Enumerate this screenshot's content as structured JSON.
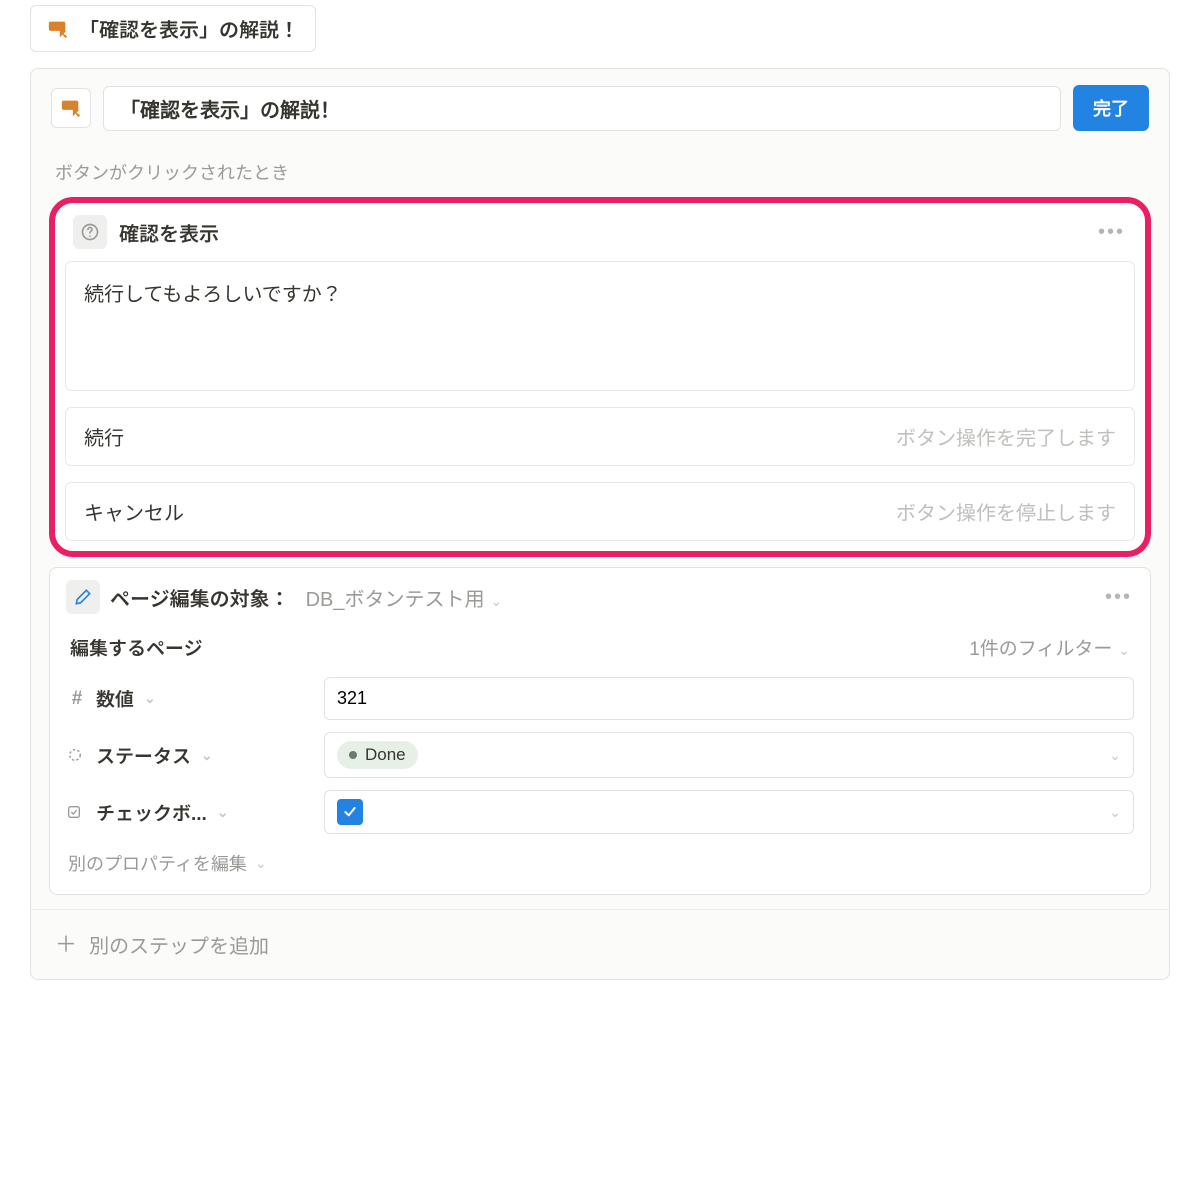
{
  "topChip": {
    "label": "「確認を表示」の解説！"
  },
  "header": {
    "title": "「確認を表示」の解説！",
    "done": "完了"
  },
  "trigger": "ボタンがクリックされたとき",
  "confirm": {
    "title": "確認を表示",
    "message": "続行してもよろしいですか？",
    "ok": {
      "label": "続行",
      "hint": "ボタン操作を完了します"
    },
    "cancel": {
      "label": "キャンセル",
      "hint": "ボタン操作を停止します"
    }
  },
  "edit": {
    "title": "ページ編集の対象：",
    "target": "DB_ボタンテスト用",
    "pagesLabel": "編集するページ",
    "filterLabel": "1件のフィルター",
    "props": {
      "number": {
        "key": "数値",
        "value": "321"
      },
      "status": {
        "key": "ステータス",
        "value": "Done"
      },
      "checkbox": {
        "key": "チェックボ...",
        "value": true
      }
    },
    "addProp": "別のプロパティを編集"
  },
  "addStep": "別のステップを追加"
}
